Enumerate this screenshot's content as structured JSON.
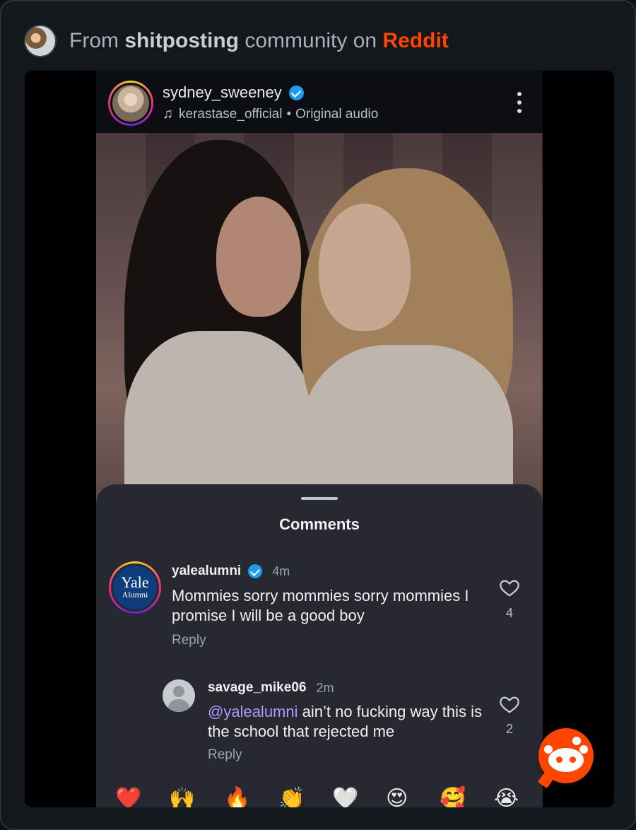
{
  "header": {
    "prefix": "From",
    "community": "shitposting",
    "middle": "community on",
    "brand": "Reddit"
  },
  "reel": {
    "username": "sydney_sweeney",
    "audio_account": "kerastase_official",
    "audio_separator": "•",
    "audio_label": "Original audio"
  },
  "comments_sheet": {
    "title": "Comments",
    "comments": [
      {
        "username": "yalealumni",
        "verified": true,
        "time": "4m",
        "text": "Mommies sorry mommies sorry mommies I promise I will be a good boy",
        "reply_label": "Reply",
        "likes": "4",
        "avatar_lines": [
          "Yale",
          "Alumni"
        ]
      },
      {
        "username": "savage_mike06",
        "verified": false,
        "time": "2m",
        "mention": "@yalealumni",
        "text": " ain’t no fucking way this is the school that rejected me",
        "reply_label": "Reply",
        "likes": "2"
      }
    ],
    "quick_reactions": [
      "❤️",
      "🙌",
      "🔥",
      "👏",
      "🤍",
      "😍",
      "🥰",
      "😭"
    ]
  },
  "colors": {
    "reddit_orange": "#ff4500",
    "verified_blue": "#1d9bf0",
    "mention": "#a89cff",
    "sheet_bg": "#262a30"
  },
  "icons": {
    "note": "music-note-icon",
    "more": "more-vertical-icon",
    "heart": "heart-outline-icon",
    "fab": "reddit-snoo-icon"
  }
}
